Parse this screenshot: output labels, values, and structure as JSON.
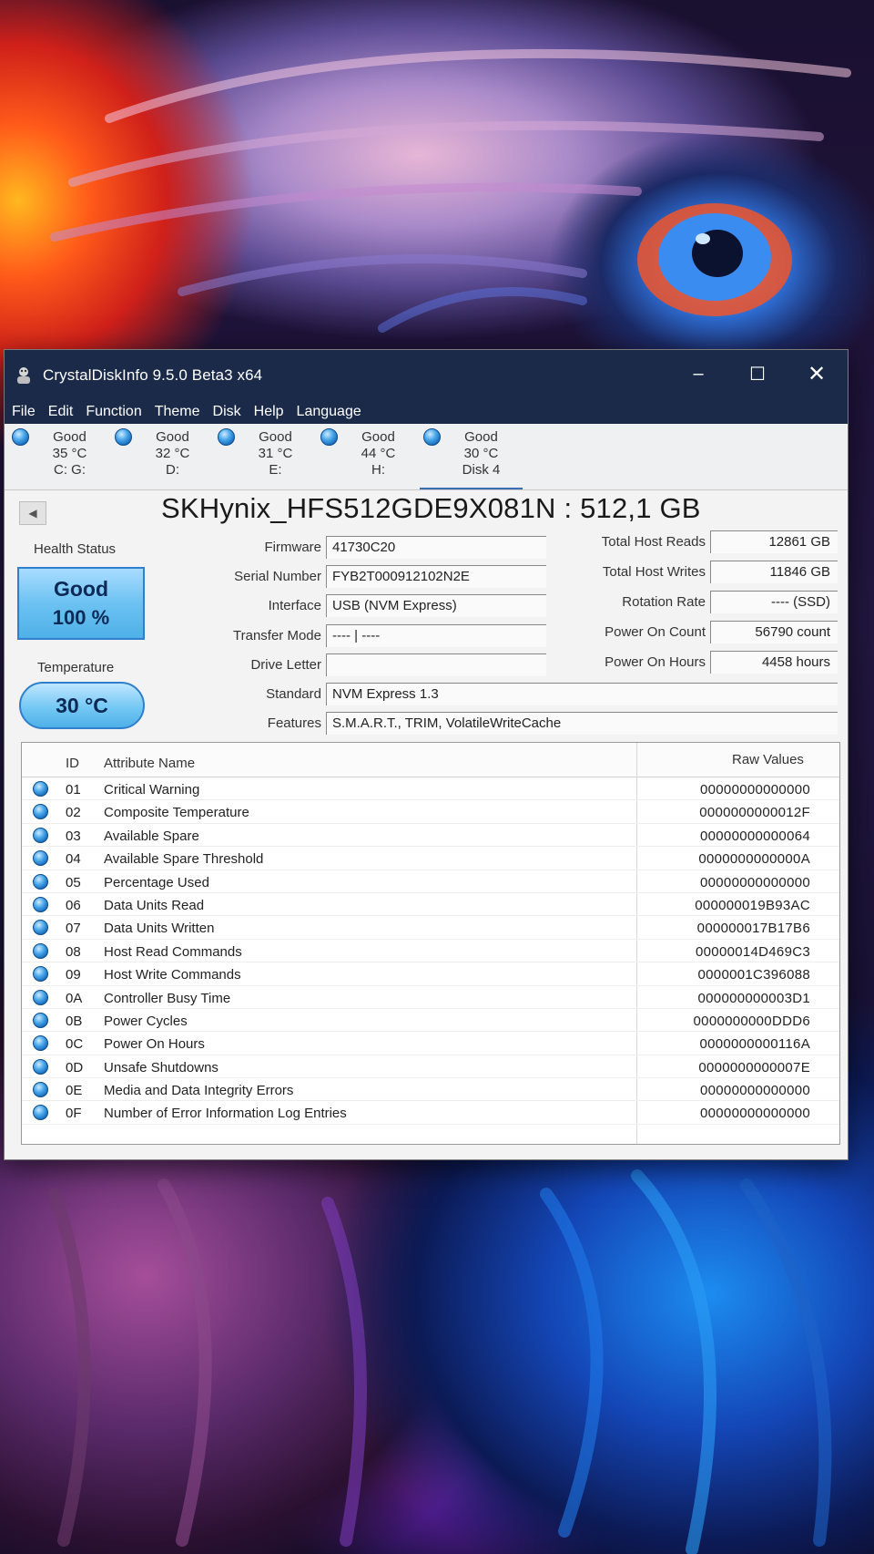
{
  "window": {
    "title": "CrystalDiskInfo 9.5.0 Beta3 x64",
    "minimize": "–",
    "maximize": "☐",
    "close": "✕"
  },
  "menu": [
    "File",
    "Edit",
    "Function",
    "Theme",
    "Disk",
    "Help",
    "Language"
  ],
  "disks": [
    {
      "status": "Good",
      "temp": "35 °C",
      "letter": "C: G:"
    },
    {
      "status": "Good",
      "temp": "32 °C",
      "letter": "D:"
    },
    {
      "status": "Good",
      "temp": "31 °C",
      "letter": "E:"
    },
    {
      "status": "Good",
      "temp": "44 °C",
      "letter": "H:"
    },
    {
      "status": "Good",
      "temp": "30 °C",
      "letter": "Disk 4"
    }
  ],
  "drive": {
    "title": "SKHynix_HFS512GDE9X081N : 512,1 GB",
    "back": "◀"
  },
  "health": {
    "label": "Health Status",
    "status": "Good",
    "percent": "100 %",
    "color": "#6cc2f2"
  },
  "temperature": {
    "label": "Temperature",
    "value": "30 °C"
  },
  "fields": [
    {
      "label": "Firmware",
      "value": "41730C20"
    },
    {
      "label": "Serial Number",
      "value": "FYB2T000912102N2E"
    },
    {
      "label": "Interface",
      "value": "USB (NVM Express)"
    },
    {
      "label": "Transfer Mode",
      "value": "---- | ----"
    },
    {
      "label": "Drive Letter",
      "value": ""
    },
    {
      "label": "Standard",
      "value": "NVM Express 1.3"
    },
    {
      "label": "Features",
      "value": "S.M.A.R.T., TRIM, VolatileWriteCache"
    }
  ],
  "right_fields": [
    {
      "label": "Total Host Reads",
      "value": "12861 GB"
    },
    {
      "label": "Total Host Writes",
      "value": "11846 GB"
    },
    {
      "label": "Rotation Rate",
      "value": "---- (SSD)"
    },
    {
      "label": "Power On Count",
      "value": "56790 count"
    },
    {
      "label": "Power On Hours",
      "value": "4458 hours"
    }
  ],
  "table": {
    "headers": {
      "id": "ID",
      "name": "Attribute Name",
      "raw": "Raw Values"
    },
    "rows": [
      {
        "id": "01",
        "name": "Critical Warning",
        "raw": "00000000000000"
      },
      {
        "id": "02",
        "name": "Composite Temperature",
        "raw": "0000000000012F"
      },
      {
        "id": "03",
        "name": "Available Spare",
        "raw": "00000000000064"
      },
      {
        "id": "04",
        "name": "Available Spare Threshold",
        "raw": "0000000000000A"
      },
      {
        "id": "05",
        "name": "Percentage Used",
        "raw": "00000000000000"
      },
      {
        "id": "06",
        "name": "Data Units Read",
        "raw": "000000019B93AC"
      },
      {
        "id": "07",
        "name": "Data Units Written",
        "raw": "000000017B17B6"
      },
      {
        "id": "08",
        "name": "Host Read Commands",
        "raw": "00000014D469C3"
      },
      {
        "id": "09",
        "name": "Host Write Commands",
        "raw": "0000001C396088"
      },
      {
        "id": "0A",
        "name": "Controller Busy Time",
        "raw": "000000000003D1"
      },
      {
        "id": "0B",
        "name": "Power Cycles",
        "raw": "0000000000DDD6"
      },
      {
        "id": "0C",
        "name": "Power On Hours",
        "raw": "0000000000116A"
      },
      {
        "id": "0D",
        "name": "Unsafe Shutdowns",
        "raw": "0000000000007E"
      },
      {
        "id": "0E",
        "name": "Media and Data Integrity Errors",
        "raw": "00000000000000"
      },
      {
        "id": "0F",
        "name": "Number of Error Information Log Entries",
        "raw": "00000000000000"
      }
    ]
  }
}
